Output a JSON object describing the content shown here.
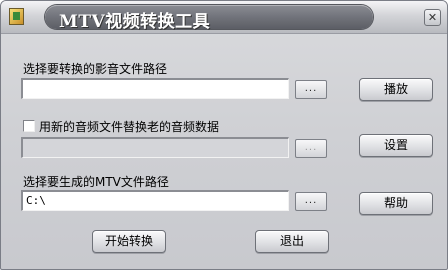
{
  "window": {
    "title": "MTV视频转换工具",
    "close_label": "✕"
  },
  "source": {
    "label": "选择要转换的影音文件路径",
    "value": "",
    "browse_label": "...",
    "play_label": "播放"
  },
  "audio": {
    "checkbox_label": "用新的音频文件替换老的音频数据",
    "checked": false,
    "value": "",
    "browse_label": "...",
    "settings_label": "设置"
  },
  "output": {
    "label": "选择要生成的MTV文件路径",
    "value": "C:\\",
    "browse_label": "...",
    "help_label": "帮助"
  },
  "actions": {
    "start_label": "开始转换",
    "exit_label": "退出"
  }
}
